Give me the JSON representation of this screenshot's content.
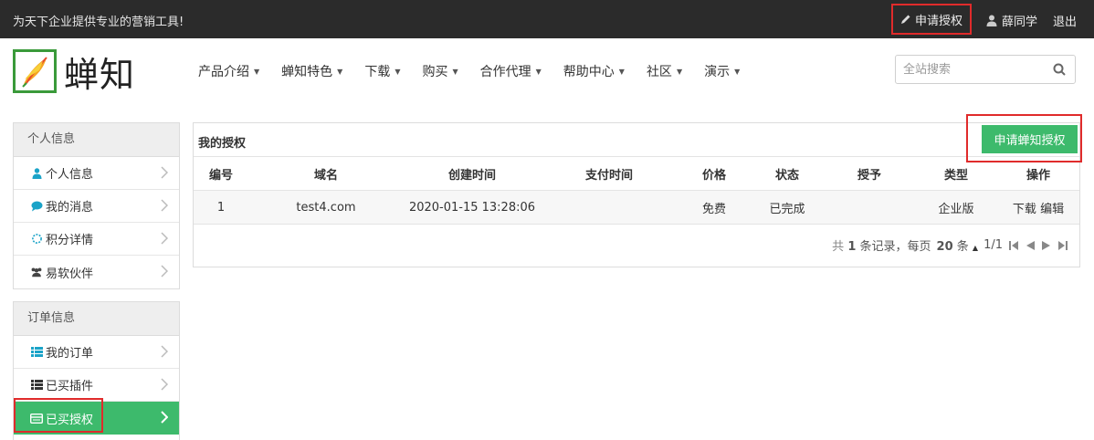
{
  "topbar": {
    "slogan": "为天下企业提供专业的营销工具!",
    "apply_label": "申请授权",
    "user_name": "薛同学",
    "logout_label": "退出"
  },
  "header": {
    "logo_text": "蝉知",
    "nav": [
      {
        "label": "产品介绍"
      },
      {
        "label": "蝉知特色"
      },
      {
        "label": "下载"
      },
      {
        "label": "购买"
      },
      {
        "label": "合作代理"
      },
      {
        "label": "帮助中心"
      },
      {
        "label": "社区"
      },
      {
        "label": "演示"
      }
    ],
    "search_placeholder": "全站搜索"
  },
  "sidebar": {
    "personal": {
      "heading": "个人信息",
      "items": [
        {
          "label": "个人信息",
          "icon": "user-icon"
        },
        {
          "label": "我的消息",
          "icon": "comment-icon"
        },
        {
          "label": "积分详情",
          "icon": "points-icon"
        },
        {
          "label": "易软伙伴",
          "icon": "group-icon"
        }
      ]
    },
    "orders": {
      "heading": "订单信息",
      "items": [
        {
          "label": "我的订单",
          "icon": "list-icon"
        },
        {
          "label": "已买插件",
          "icon": "list-icon"
        },
        {
          "label": "已买授权",
          "icon": "card-icon",
          "active": true
        }
      ]
    }
  },
  "main": {
    "title": "我的授权",
    "apply_button": "申请蝉知授权",
    "columns": [
      "编号",
      "域名",
      "创建时间",
      "支付时间",
      "价格",
      "状态",
      "授予",
      "类型",
      "操作"
    ],
    "rows": [
      {
        "id": "1",
        "domain": "test4.com",
        "created": "2020-01-15 13:28:06",
        "paid": "",
        "price": "免费",
        "status": "已完成",
        "grant": "",
        "type": "企业版",
        "action_download": "下载",
        "action_edit": "编辑"
      }
    ],
    "pager": {
      "prefix": "共",
      "total": "1",
      "suffix": "条记录，每页",
      "per_page": "20",
      "unit": "条",
      "page": "1/1"
    }
  },
  "colors": {
    "accent": "#3dba6c",
    "topbar": "#2b2b2b",
    "highlight": "#e02b2b"
  }
}
